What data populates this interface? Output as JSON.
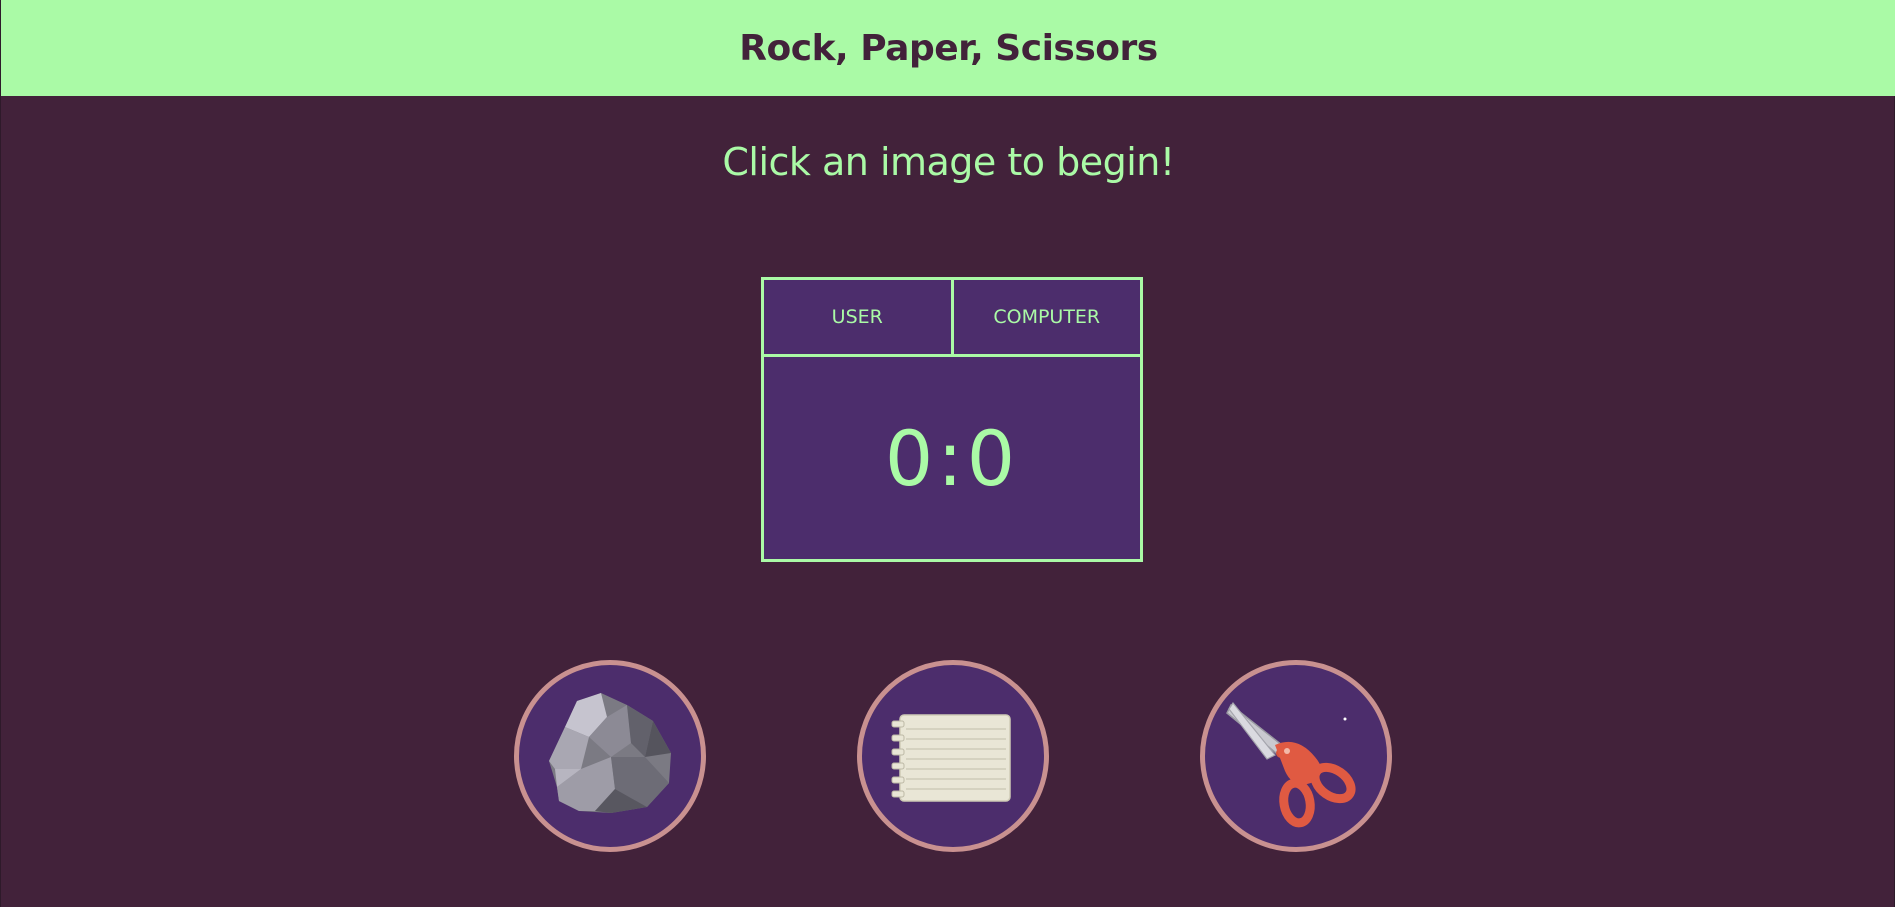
{
  "header": {
    "title": "Rock, Paper, Scissors"
  },
  "message": "Click an image to begin!",
  "scoreboard": {
    "user_label": "USER",
    "computer_label": "COMPUTER",
    "user_score": "0",
    "separator": ":",
    "computer_score": "0"
  },
  "choices": [
    {
      "name": "rock",
      "icon": "rock-icon"
    },
    {
      "name": "paper",
      "icon": "paper-icon"
    },
    {
      "name": "scissors",
      "icon": "scissors-icon"
    }
  ],
  "colors": {
    "background": "#42223a",
    "header_bg": "#aafaa6",
    "accent": "#aafaa6",
    "panel": "#4c2d6c",
    "choice_border": "#c99190"
  }
}
